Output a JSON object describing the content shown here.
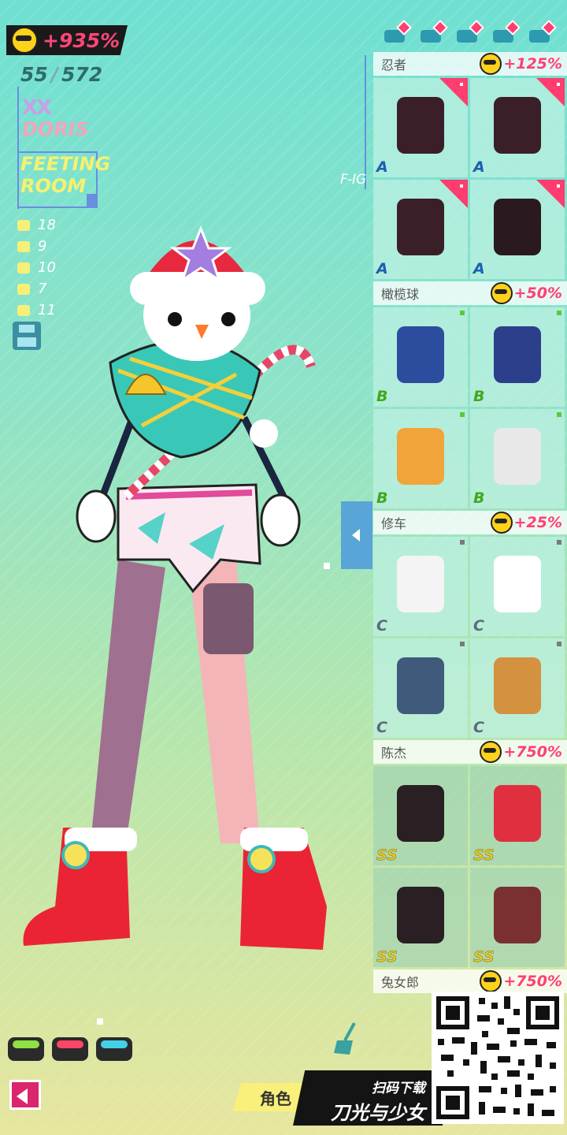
{
  "bonus": {
    "total": "+935%"
  },
  "counter": {
    "current": "55",
    "total": "572"
  },
  "profile": {
    "mark": "XX",
    "name": "DORIS",
    "room_line1": "FEETING",
    "room_line2": "ROOM"
  },
  "stats": [
    {
      "icon": "hat-icon",
      "value": "18"
    },
    {
      "icon": "top-icon",
      "value": "9"
    },
    {
      "icon": "glove-icon",
      "value": "10"
    },
    {
      "icon": "pants-icon",
      "value": "7"
    },
    {
      "icon": "shoe-icon",
      "value": "11"
    }
  ],
  "figure_tag": "F-IG",
  "top_icons": [
    "hat-filter-icon",
    "top-filter-icon",
    "glove-filter-icon",
    "boot-filter-icon",
    "shoe-filter-icon"
  ],
  "sets": [
    {
      "name": "忍者",
      "bonus": "+125%",
      "items": [
        {
          "grade": "A",
          "icon": "ninja-top",
          "color": "#3a1f28"
        },
        {
          "grade": "A",
          "icon": "ninja-arm-guards",
          "color": "#3a1f28"
        },
        {
          "grade": "A",
          "icon": "ninja-shorts",
          "color": "#3a1f28"
        },
        {
          "grade": "A",
          "icon": "ninja-boots",
          "color": "#2a1a20"
        }
      ]
    },
    {
      "name": "橄榄球",
      "bonus": "+50%",
      "items": [
        {
          "grade": "B",
          "icon": "football-jersey",
          "color": "#2c4c9e"
        },
        {
          "grade": "B",
          "icon": "football-gloves",
          "color": "#2c3f8a"
        },
        {
          "grade": "B",
          "icon": "football-pants",
          "color": "#f1a43a"
        },
        {
          "grade": "B",
          "icon": "football-socks",
          "color": "#e8e8e8"
        }
      ]
    },
    {
      "name": "修车",
      "bonus": "+25%",
      "items": [
        {
          "grade": "C",
          "icon": "mechanic-shirt",
          "color": "#f4f4f4"
        },
        {
          "grade": "C",
          "icon": "mechanic-gloves",
          "color": "#ffffff"
        },
        {
          "grade": "C",
          "icon": "mechanic-shorts",
          "color": "#3f5a7a"
        },
        {
          "grade": "C",
          "icon": "mechanic-boots",
          "color": "#d49140"
        }
      ]
    },
    {
      "name": "陈杰",
      "bonus": "+750%",
      "items": [
        {
          "grade": "SS",
          "icon": "chenjie-top",
          "color": "#2a1f22"
        },
        {
          "grade": "SS",
          "icon": "chenjie-gauntlet",
          "color": "#e03040"
        },
        {
          "grade": "SS",
          "icon": "chenjie-pants",
          "color": "#2a1f22"
        },
        {
          "grade": "SS",
          "icon": "chenjie-shoes",
          "color": "#7a3030"
        }
      ]
    },
    {
      "name": "兔女郎",
      "bonus": "+750%",
      "items": []
    }
  ],
  "slots": [
    {
      "color": "#8ee043"
    },
    {
      "color": "#ff4466"
    },
    {
      "color": "#43d1e8"
    }
  ],
  "bottom": {
    "role_tab": "角色",
    "promo_small": "扫码下载",
    "promo_big": "刀光与少女"
  }
}
